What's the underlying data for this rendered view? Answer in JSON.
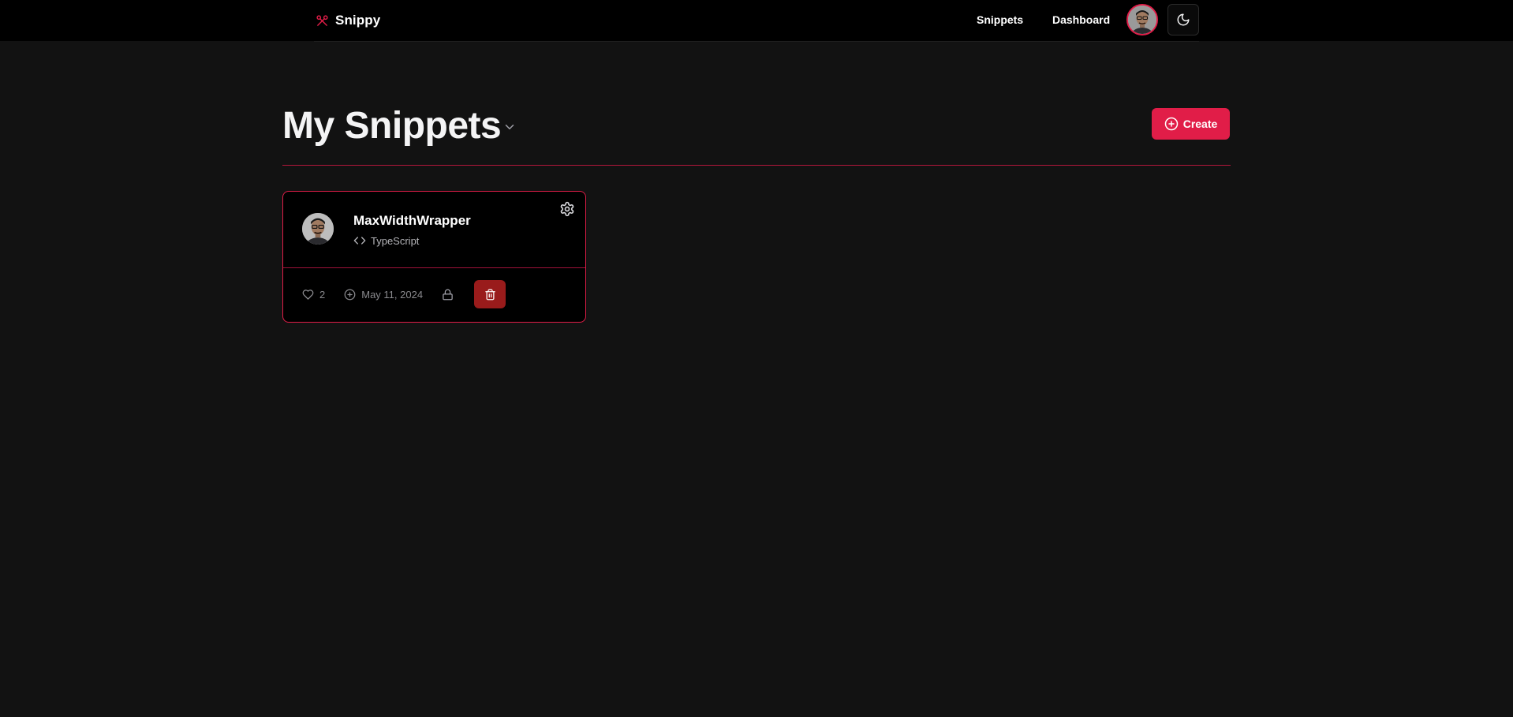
{
  "nav": {
    "brand": "Snippy",
    "links": [
      "Snippets",
      "Dashboard"
    ],
    "avatar_alt": "user avatar",
    "theme_icon": "moon-icon"
  },
  "page": {
    "title": "My Snippets",
    "create_label": "Create"
  },
  "snippets": [
    {
      "title": "MaxWidthWrapper",
      "language": "TypeScript",
      "likes": "2",
      "created": "May 11, 2024",
      "visibility_icon": "lock-icon"
    }
  ],
  "colors": {
    "accent": "#e11d48",
    "delete": "#991b1b",
    "background": "#121212",
    "nav_background": "#000000"
  }
}
